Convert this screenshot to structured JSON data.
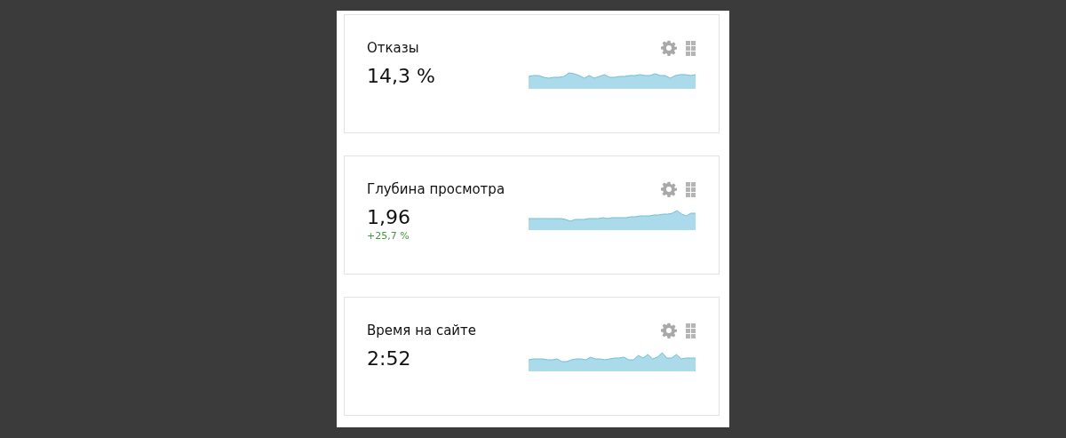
{
  "widgets": [
    {
      "title": "Отказы",
      "value": "14,3 %"
    },
    {
      "title": "Глубина просмотра",
      "value": "1,96",
      "change": "+25,7 %"
    },
    {
      "title": "Время на сайте",
      "value": "2:52"
    }
  ]
}
